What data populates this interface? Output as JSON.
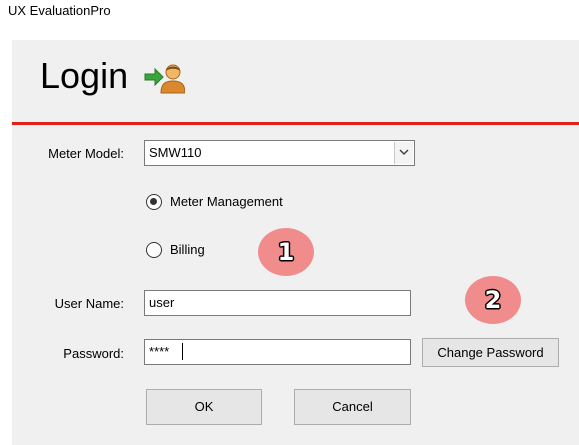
{
  "window": {
    "title": "UX EvaluationPro"
  },
  "header": {
    "title": "Login",
    "icon": "login-user-arrow-icon",
    "accent_color": "#e0201a"
  },
  "form": {
    "meter_model": {
      "label": "Meter Model:",
      "selected": "SMW110"
    },
    "modes": [
      {
        "label": "Meter Management",
        "checked": true
      },
      {
        "label": "Billing",
        "checked": false
      }
    ],
    "username": {
      "label": "User Name:",
      "value": "user"
    },
    "password": {
      "label": "Password:",
      "value": "****"
    }
  },
  "buttons": {
    "change_password": "Change Password",
    "ok": "OK",
    "cancel": "Cancel"
  },
  "annotations": {
    "badge_1": "1",
    "badge_2": "2",
    "color": "#f08c8c"
  }
}
